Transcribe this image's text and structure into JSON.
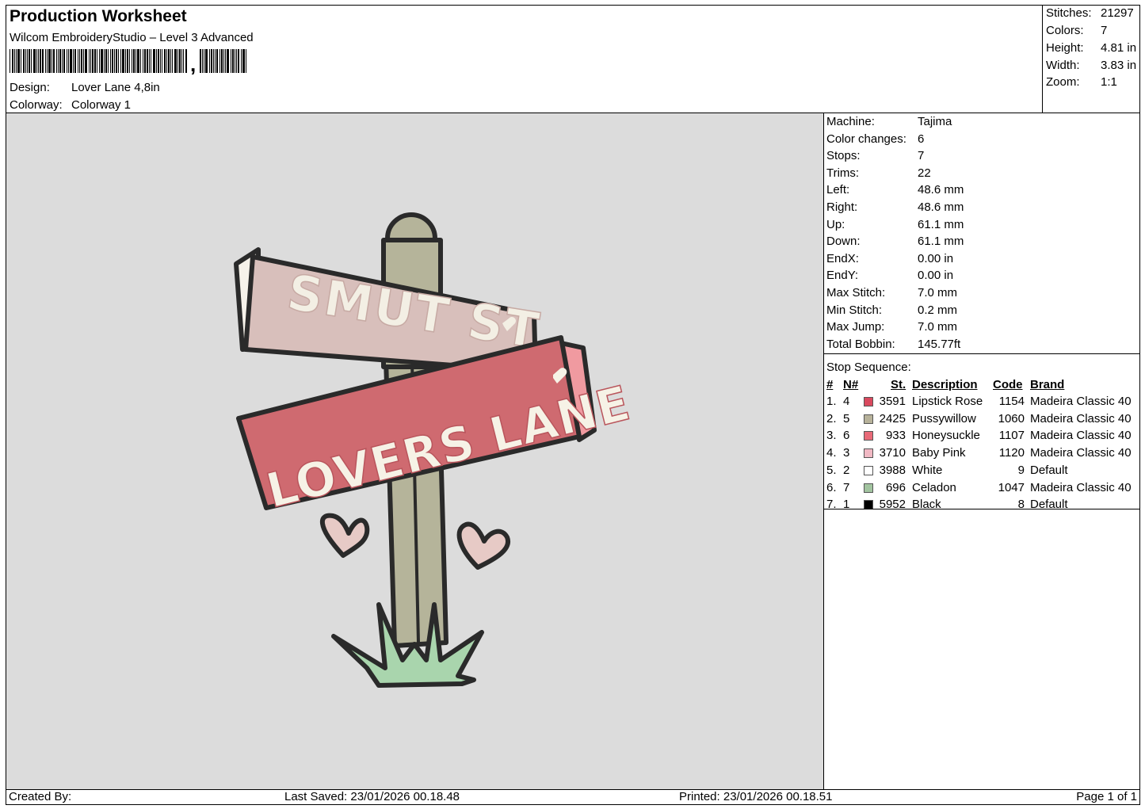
{
  "header": {
    "title": "Production Worksheet",
    "software": "Wilcom EmbroideryStudio – Level 3 Advanced",
    "design_label": "Design:",
    "design_value": "Lover Lane 4,8in",
    "colorway_label": "Colorway:",
    "colorway_value": "Colorway 1"
  },
  "summary": {
    "stitches_label": "Stitches:",
    "stitches_value": "21297",
    "colors_label": "Colors:",
    "colors_value": "7",
    "height_label": "Height:",
    "height_value": "4.81 in",
    "width_label": "Width:",
    "width_value": "3.83 in",
    "zoom_label": "Zoom:",
    "zoom_value": "1:1"
  },
  "machine_info": [
    {
      "label": "Machine:",
      "value": "Tajima"
    },
    {
      "label": "Color changes:",
      "value": "6"
    },
    {
      "label": "Stops:",
      "value": "7"
    },
    {
      "label": "Trims:",
      "value": "22"
    },
    {
      "label": "Left:",
      "value": "48.6 mm"
    },
    {
      "label": "Right:",
      "value": "48.6 mm"
    },
    {
      "label": "Up:",
      "value": "61.1 mm"
    },
    {
      "label": "Down:",
      "value": "61.1 mm"
    },
    {
      "label": "EndX:",
      "value": "0.00 in"
    },
    {
      "label": "EndY:",
      "value": "0.00 in"
    },
    {
      "label": "Max Stitch:",
      "value": "7.0 mm"
    },
    {
      "label": "Min Stitch:",
      "value": "0.2 mm"
    },
    {
      "label": "Max Jump:",
      "value": "7.0 mm"
    },
    {
      "label": "Total Bobbin:",
      "value": "145.77ft"
    }
  ],
  "stop_sequence": {
    "title": "Stop Sequence:",
    "headers": {
      "hash": "#",
      "n": "N#",
      "st": "St.",
      "description": "Description",
      "code": "Code",
      "brand": "Brand"
    },
    "rows": [
      {
        "idx": "1.",
        "n": "4",
        "st": "3591",
        "description": "Lipstick Rose",
        "code": "1154",
        "brand": "Madeira Classic 40",
        "color": "#d9495e"
      },
      {
        "idx": "2.",
        "n": "5",
        "st": "2425",
        "description": "Pussywillow",
        "code": "1060",
        "brand": "Madeira Classic 40",
        "color": "#b7b29a"
      },
      {
        "idx": "3.",
        "n": "6",
        "st": "933",
        "description": "Honeysuckle",
        "code": "1107",
        "brand": "Madeira Classic 40",
        "color": "#e86a78"
      },
      {
        "idx": "4.",
        "n": "3",
        "st": "3710",
        "description": "Baby Pink",
        "code": "1120",
        "brand": "Madeira Classic 40",
        "color": "#f1b9c4"
      },
      {
        "idx": "5.",
        "n": "2",
        "st": "3988",
        "description": "White",
        "code": "9",
        "brand": "Default",
        "color": "#ffffff"
      },
      {
        "idx": "6.",
        "n": "7",
        "st": "696",
        "description": "Celadon",
        "code": "1047",
        "brand": "Madeira Classic 40",
        "color": "#a2c4a0"
      },
      {
        "idx": "7.",
        "n": "1",
        "st": "5952",
        "description": "Black",
        "code": "8",
        "brand": "Default",
        "color": "#000000"
      }
    ]
  },
  "design_preview": {
    "sign_top_text": "SMUT ST",
    "sign_bottom_text": "LOVERS LANE"
  },
  "footer": {
    "created_by": "Created By:",
    "last_saved": "Last Saved: 23/01/2026 00.18.48",
    "printed": "Printed: 23/01/2026 00.18.51",
    "page": "Page 1 of 1"
  }
}
